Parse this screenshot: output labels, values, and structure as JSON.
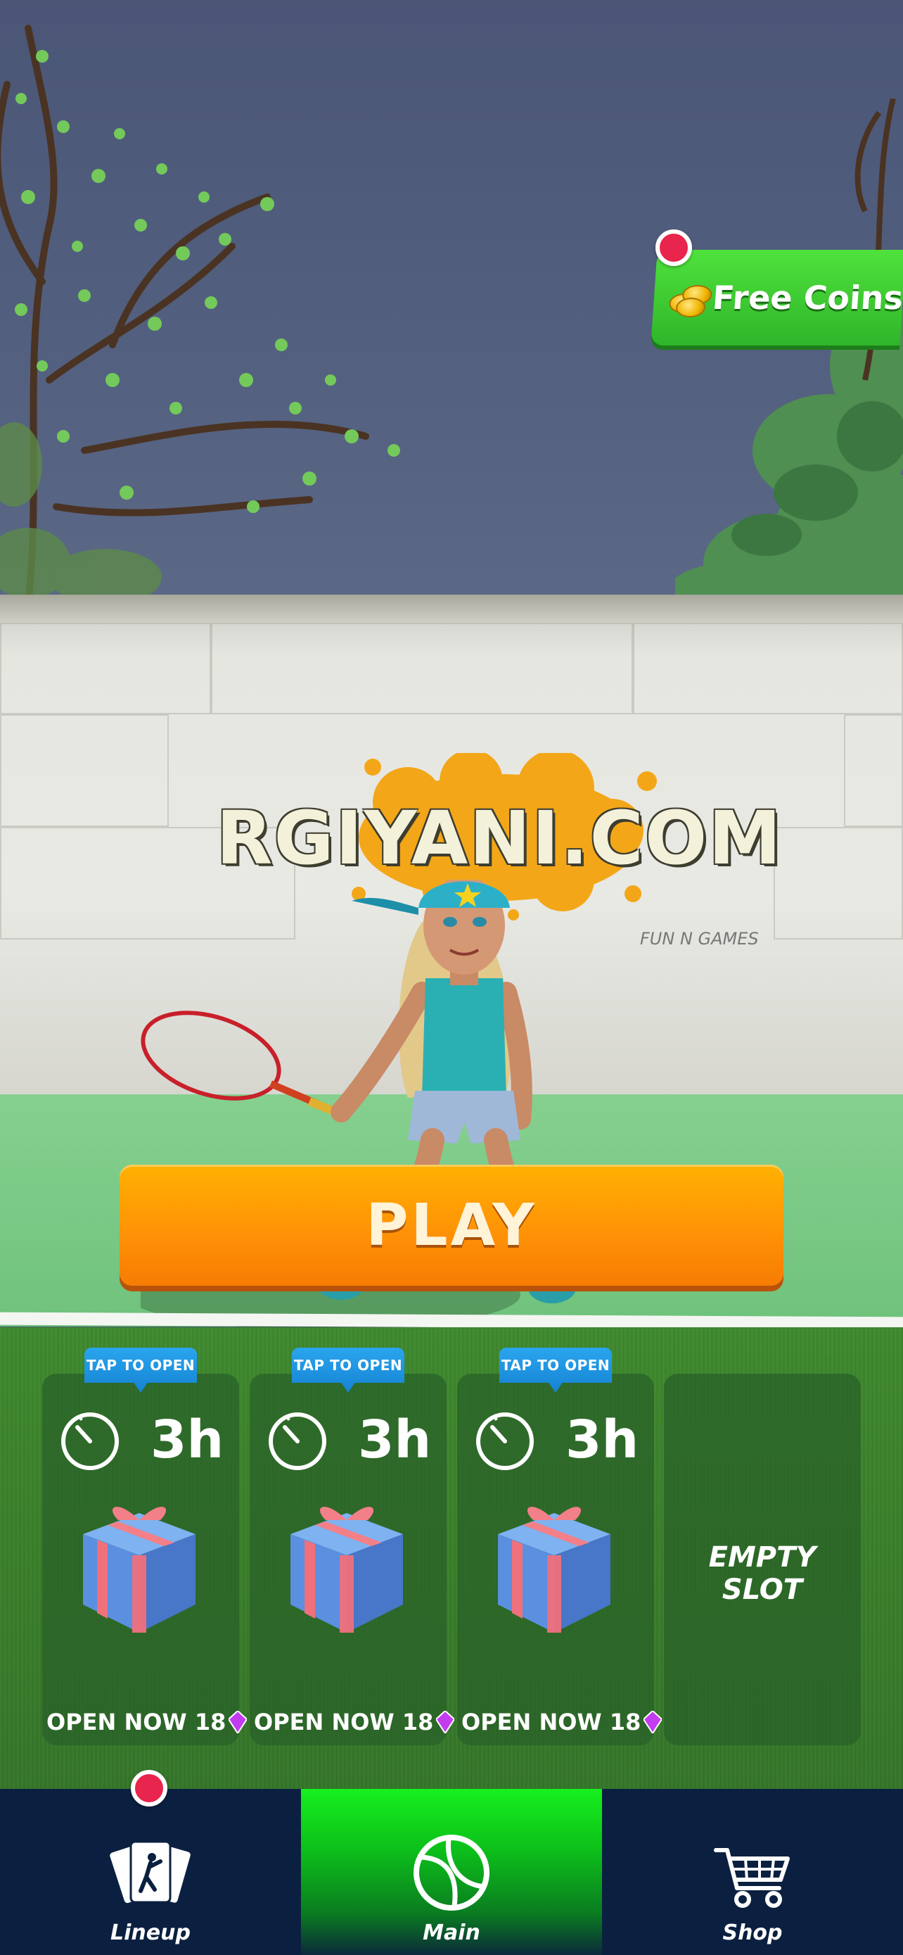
{
  "promo": {
    "free_coins_label": "Free Coins"
  },
  "wall_logo": {
    "text": "RGIYANI.COM",
    "sub": "FUN N GAMES"
  },
  "play": {
    "label": "PLAY"
  },
  "chests": [
    {
      "tab": "TAP TO OPEN",
      "timer": "3h",
      "open_now": "OPEN NOW 18"
    },
    {
      "tab": "TAP TO OPEN",
      "timer": "3h",
      "open_now": "OPEN NOW 18"
    },
    {
      "tab": "TAP TO OPEN",
      "timer": "3h",
      "open_now": "OPEN NOW 18"
    }
  ],
  "empty_slot": {
    "label": "EMPTY SLOT"
  },
  "nav": {
    "lineup": "Lineup",
    "main": "Main",
    "shop": "Shop"
  },
  "colors": {
    "play_button": "#ff9306",
    "free_coins": "#2fb52a",
    "notification": "#e8254d",
    "tab_blue": "#1583d3",
    "gem": "#c23cf0",
    "nav_bg": "#0b2040",
    "nav_active": "#16f01e"
  },
  "icons": {
    "timer": "stopwatch-icon",
    "chest": "gift-box-icon",
    "gem": "gem-icon",
    "lineup": "cards-icon",
    "main": "tennis-ball-icon",
    "shop": "cart-icon",
    "coins": "coins-icon"
  }
}
